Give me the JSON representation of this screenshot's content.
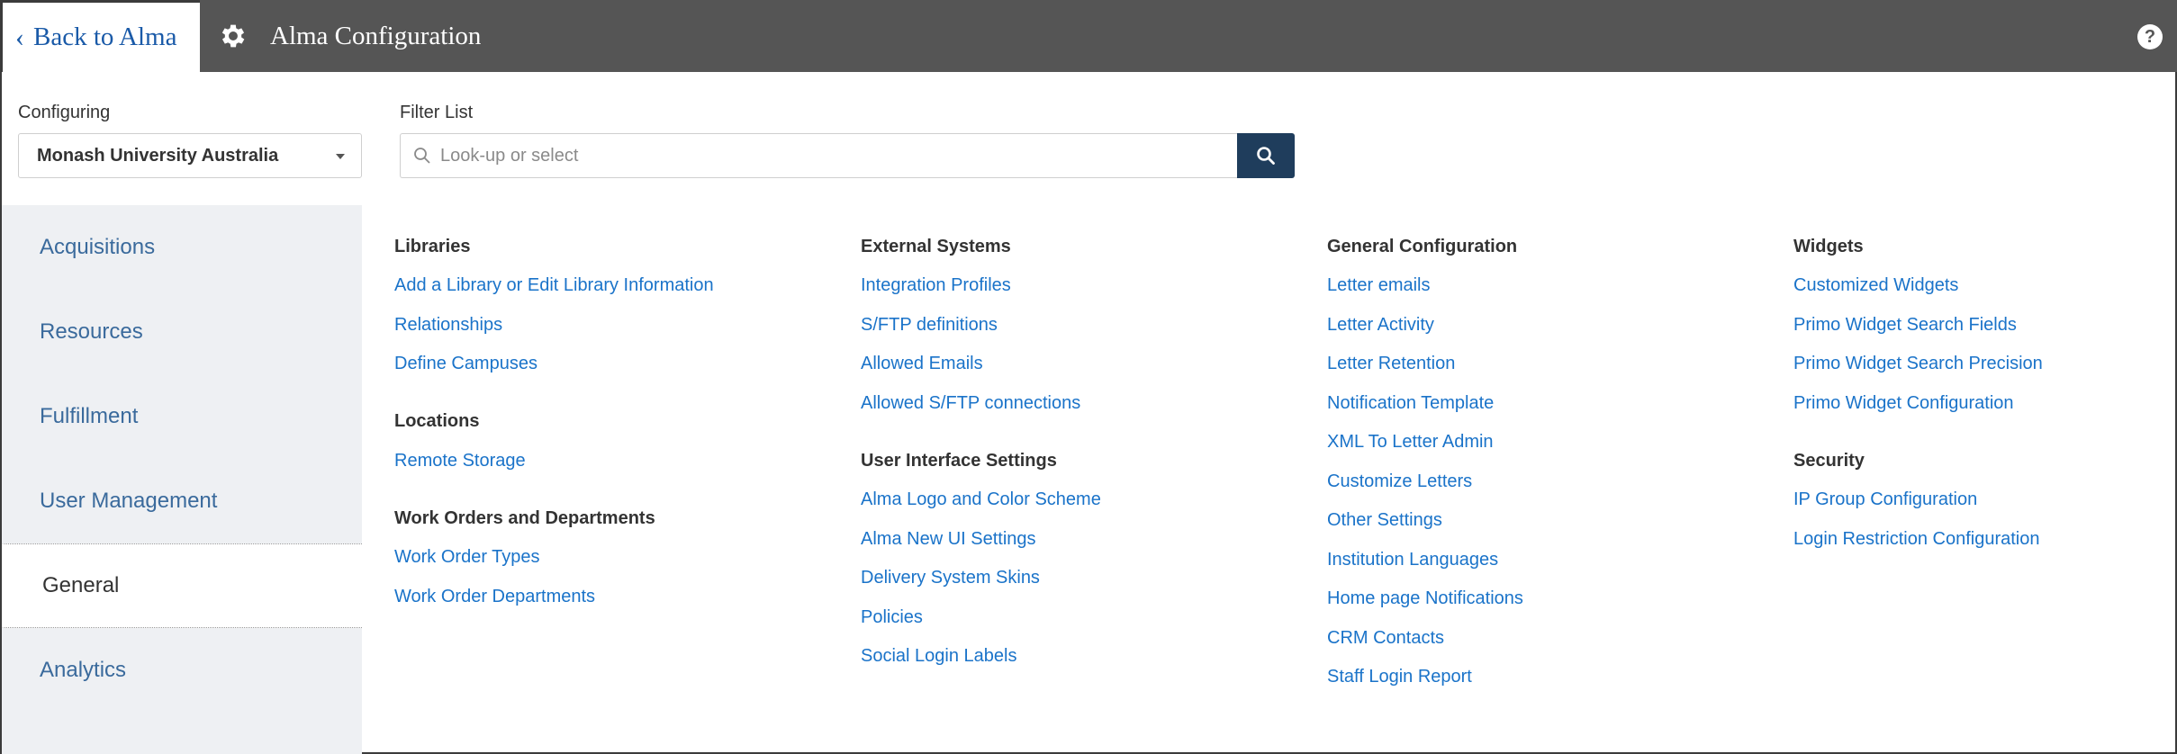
{
  "header": {
    "back_label": "Back to Alma",
    "title": "Alma Configuration",
    "help_glyph": "?"
  },
  "configuring": {
    "label": "Configuring",
    "selected": "Monash University Australia"
  },
  "filter": {
    "label": "Filter List",
    "placeholder": "Look-up or select"
  },
  "sidebar": {
    "items": [
      {
        "label": "Acquisitions"
      },
      {
        "label": "Resources"
      },
      {
        "label": "Fulfillment"
      },
      {
        "label": "User Management"
      },
      {
        "label": "General",
        "active": true
      },
      {
        "label": "Analytics"
      }
    ]
  },
  "columns": [
    {
      "sections": [
        {
          "title": "Libraries",
          "links": [
            "Add a Library or Edit Library Information",
            "Relationships",
            "Define Campuses"
          ]
        },
        {
          "title": "Locations",
          "links": [
            "Remote Storage"
          ]
        },
        {
          "title": "Work Orders and Departments",
          "links": [
            "Work Order Types",
            "Work Order Departments"
          ]
        }
      ]
    },
    {
      "sections": [
        {
          "title": "External Systems",
          "links": [
            "Integration Profiles",
            "S/FTP definitions",
            "Allowed Emails",
            "Allowed S/FTP connections"
          ]
        },
        {
          "title": "User Interface Settings",
          "links": [
            "Alma Logo and Color Scheme",
            "Alma New UI Settings",
            "Delivery System Skins",
            "Policies",
            "Social Login Labels"
          ]
        }
      ]
    },
    {
      "sections": [
        {
          "title": "General Configuration",
          "links": [
            "Letter emails",
            "Letter Activity",
            "Letter Retention",
            "Notification Template",
            "XML To Letter Admin",
            "Customize Letters",
            "Other Settings",
            "Institution Languages",
            "Home page Notifications",
            "CRM Contacts",
            "Staff Login Report"
          ]
        }
      ]
    },
    {
      "sections": [
        {
          "title": "Widgets",
          "links": [
            "Customized Widgets",
            "Primo Widget Search Fields",
            "Primo Widget Search Precision",
            "Primo Widget Configuration"
          ]
        },
        {
          "title": "Security",
          "links": [
            "IP Group Configuration",
            "Login Restriction Configuration"
          ]
        }
      ]
    }
  ],
  "colors": {
    "header_bg": "#555555",
    "link": "#1a73c9",
    "search_button": "#1f3d5c",
    "sidebar_bg": "#eef0f3"
  },
  "icons": {
    "back": "chevron-left-icon",
    "title": "gear-icon",
    "help": "help-icon",
    "search": "search-icon"
  }
}
